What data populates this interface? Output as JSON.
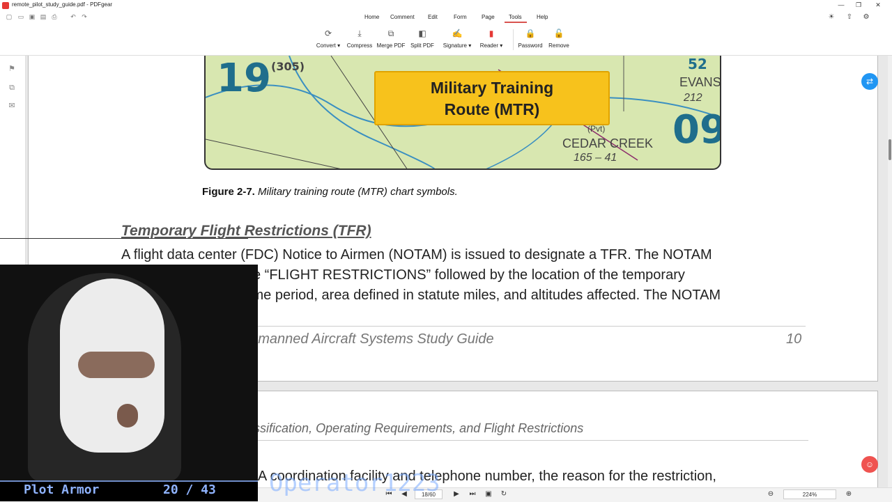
{
  "window": {
    "title": "remote_pilot_study_guide.pdf - PDFgear",
    "minimize": "—",
    "maximize": "❐",
    "close": "✕"
  },
  "menu": {
    "tabs": [
      "Home",
      "Comment",
      "Edit",
      "Form",
      "Page",
      "Tools",
      "Help"
    ],
    "active": "Tools"
  },
  "toolbar": {
    "tools": [
      {
        "label": "Convert ▾",
        "icon": "convert-icon",
        "glyph": "⟳"
      },
      {
        "label": "Compress",
        "icon": "compress-icon",
        "glyph": "⤓"
      },
      {
        "label": "Merge PDF",
        "icon": "merge-icon",
        "glyph": "⧉"
      },
      {
        "label": "Split PDF",
        "icon": "split-icon",
        "glyph": "◧"
      },
      {
        "label": "Signature ▾",
        "icon": "signature-icon",
        "glyph": "✍"
      },
      {
        "label": "Reader ▾",
        "icon": "reader-icon",
        "glyph": "▮"
      },
      {
        "label": "Password",
        "icon": "lock-icon",
        "glyph": "🔒"
      },
      {
        "label": "Remove",
        "icon": "unlock-icon",
        "glyph": "🔓"
      }
    ]
  },
  "map": {
    "callout_line1": "Military Training",
    "callout_line2": "Route (MTR)",
    "left_number": "19",
    "left_label": "(305)",
    "right_top_num": "52",
    "right_town": "EVANS",
    "right_freq": "212",
    "right_number": "09",
    "cedar_label": "CEDAR CREEK",
    "cedar_freq": "165 – 41",
    "pvt_label": "(Pvt)"
  },
  "document": {
    "figure_label": "Figure 2-7.",
    "figure_text": "Military training route (MTR) chart symbols.",
    "heading": "Temporary Flight Restrictions (TFR)",
    "line1": "A flight data center (FDC) Notice to Airmen (NOTAM) is issued to designate a TFR. The NOTAM",
    "line2": "begins with the phrase “FLIGHT RESTRICTIONS” followed by the location of the temporary",
    "line3": "restriction, effective time period, area defined in statute miles, and altitudes affected. The NOTAM",
    "footer_title": "Pilot – Small Unmanned Aircraft Systems Study Guide",
    "footer_page": "10",
    "page2_header": "Airspace Classification, Operating Requirements, and Flight Restrictions",
    "page2_line": "the FAA coordination facility and telephone number, the reason for the restriction,"
  },
  "stream": {
    "name": "Plot Armor",
    "count": "20 / 43",
    "watermark": "Operator1223"
  },
  "statusbar": {
    "page": "18/60",
    "zoom": "224%"
  }
}
